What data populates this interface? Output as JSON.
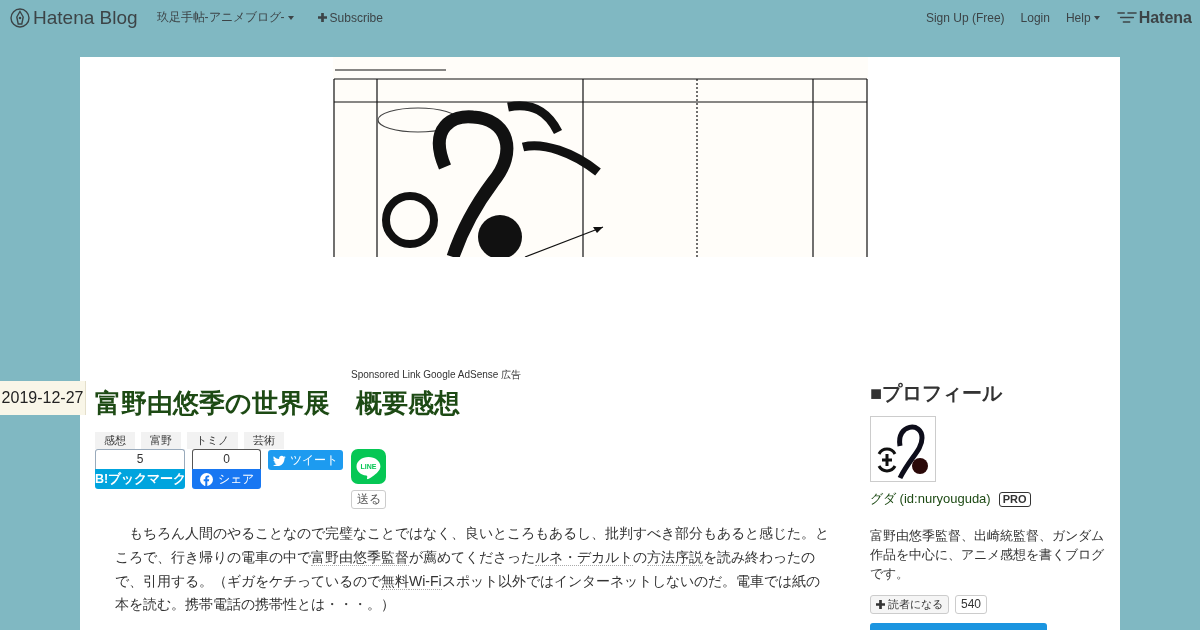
{
  "top_bar": {
    "logo": "Hatena Blog",
    "blog_title": "玖足手帖-アニメブログ-",
    "subscribe": "Subscribe",
    "sign_up": "Sign Up (Free)",
    "login": "Login",
    "help": "Help",
    "hatena_logo": "Hatena"
  },
  "ad_label": "Sponsored Link Google AdSense 広告",
  "entry": {
    "date": "2019-12-27",
    "title": "富野由悠季の世界展　概要感想",
    "categories": [
      "感想",
      "富野",
      "トミノ",
      "芸術"
    ],
    "share_buttons": [
      {
        "kind": "bookmark",
        "count": "5",
        "label": "B!ブックマーク"
      },
      {
        "kind": "facebook",
        "count": "0",
        "label": "シェア"
      },
      {
        "kind": "twitter",
        "label": "ツイート"
      },
      {
        "kind": "line",
        "logo": "LINE",
        "label": "送る"
      }
    ],
    "body": [
      {
        "kind": "text",
        "text": "　もちろん人間のやることなので完璧なことではなく、良いところもあるし、批判すべき部分もあると感じた。ところで、行き帰りの電車の中で"
      },
      {
        "kind": "keyword",
        "text": "富野由悠季監督"
      },
      {
        "kind": "text",
        "text": "が薦めてくださった"
      },
      {
        "kind": "keyword",
        "text": "ルネ・デカルト"
      },
      {
        "kind": "text",
        "text": "の"
      },
      {
        "kind": "keyword",
        "text": "方法序説"
      },
      {
        "kind": "text",
        "text": "を読み終わったので、引用する。（ギガをケチっているので"
      },
      {
        "kind": "keyword",
        "text": "無料"
      },
      {
        "kind": "keyword",
        "text": "Wi-Fi"
      },
      {
        "kind": "text",
        "text": "スポット以外ではインターネットしないのだ。電車では紙の本を読む。携帯電話の携帯性とは・・・。）"
      }
    ]
  },
  "sidebar": {
    "heading": "■プロフィール",
    "user": "グダ (id:nuryouguda)",
    "badge": "PRO",
    "description": "富野由悠季監督、出崎統監督、ガンダム作品を中心に、アニメ感想を書くブログです。",
    "subscribe_button": "読者になる",
    "subscriber_count": "540"
  }
}
